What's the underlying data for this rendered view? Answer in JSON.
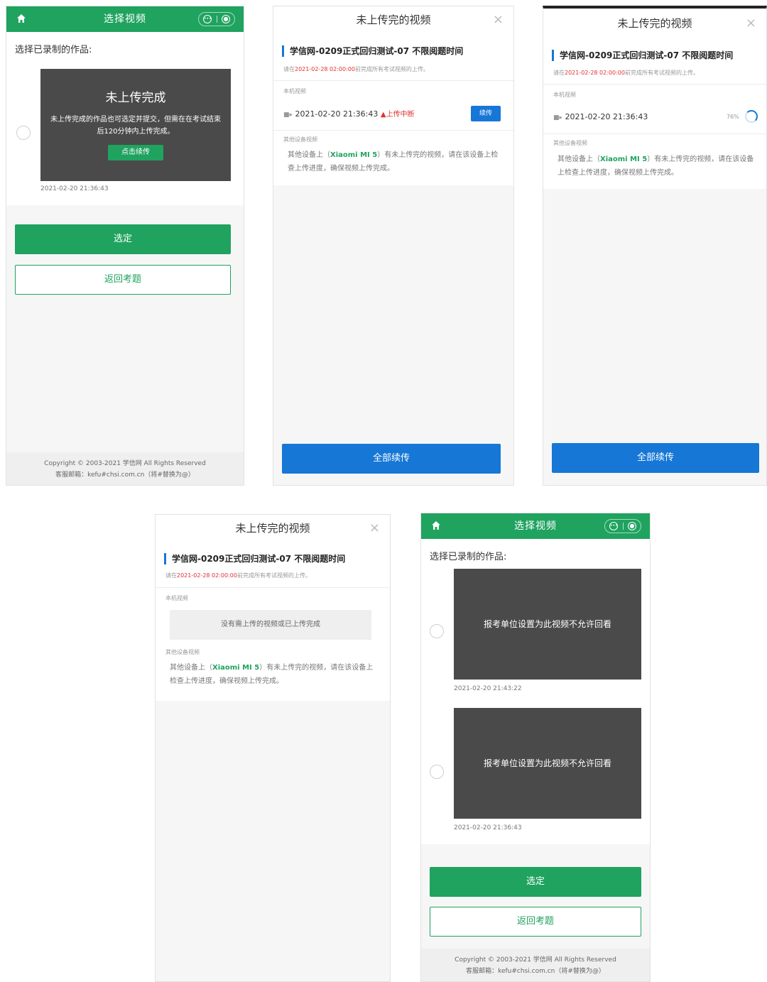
{
  "select_screen": {
    "header_title": "选择视频",
    "prompt": "选择已录制的作品:",
    "confirm_label": "选定",
    "back_label": "返回考题",
    "footer_line1": "Copyright © 2003-2021 学信网 All Rights Reserved",
    "footer_line2": "客服邮箱：kefu#chsi.com.cn（将#替换为@）",
    "screen1_video": {
      "title": "未上传完成",
      "desc": "未上传完成的作品也可选定并提交，但需在在考试结束后120分钟内上传完成。",
      "continue_label": "点击续传",
      "time": "2021-02-20 21:36:43"
    },
    "screen5_videos": [
      {
        "message": "报考单位设置为此视频不允许回看",
        "time": "2021-02-20 21:43:22"
      },
      {
        "message": "报考单位设置为此视频不允许回看",
        "time": "2021-02-20 21:36:43"
      }
    ]
  },
  "upload_modal": {
    "title": "未上传完的视频",
    "close_icon": "×",
    "exam_name": "学信网-0209正式回归测试-07 不限阅题时间",
    "deadline_prefix": "请在",
    "deadline_date": "2021-02-28 02:00:00",
    "deadline_suffix": "前完成所有考试视频的上传。",
    "local_label": "本机视频",
    "local_time": "2021-02-20 21:36:43",
    "interrupted_label": "上传中断",
    "resume_label": "续传",
    "progress_text": "76%",
    "progress_value": 76,
    "empty_message": "没有需上传的视频或已上传完成",
    "other_label": "其他设备视频",
    "other_text_prefix": "其他设备上（",
    "other_device": "Xiaomi MI 5",
    "other_text_suffix": "）有未上传完的视频，请在该设备上检查上传进度，确保视频上传完成。",
    "resume_all_label": "全部续传"
  },
  "colors": {
    "green": "#1fa35f",
    "blue": "#1677d6",
    "red": "#e0322e",
    "video_bg": "#4a4a4a"
  }
}
